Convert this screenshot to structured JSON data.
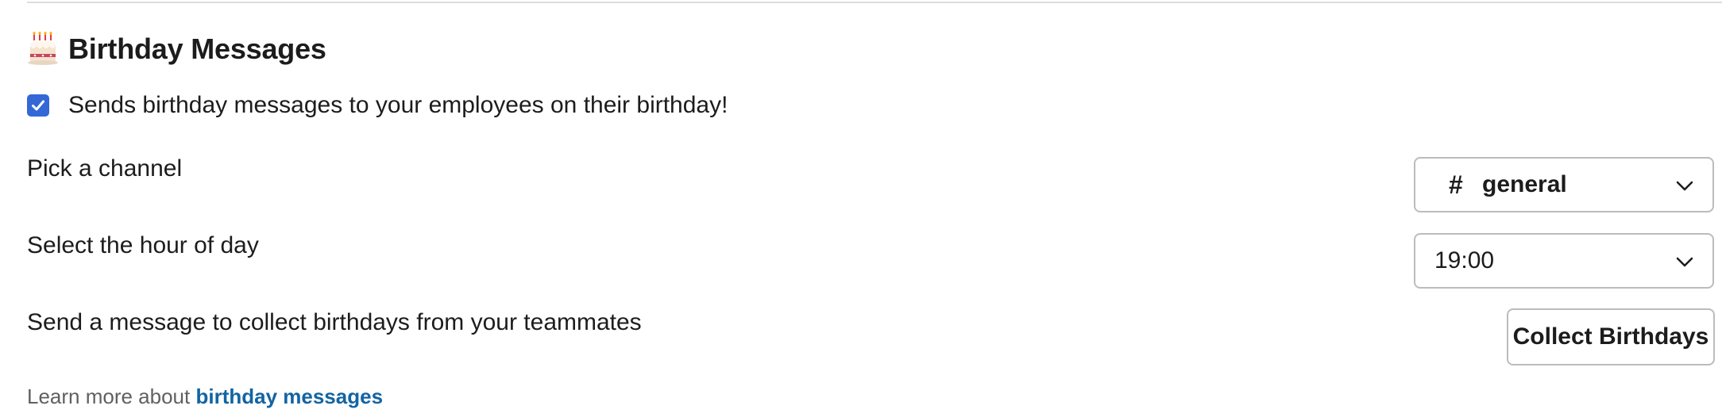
{
  "section": {
    "title": "Birthday Messages",
    "icon": "birthday-cake-icon"
  },
  "enable": {
    "checked": true,
    "label": "Sends birthday messages to your employees on their birthday!"
  },
  "channel": {
    "label": "Pick a channel",
    "prefix": "#",
    "value": "general"
  },
  "hour": {
    "label": "Select the hour of day",
    "value": "19:00"
  },
  "collect": {
    "label": "Send a message to collect birthdays from your teammates",
    "button_label": "Collect Birthdays"
  },
  "footer": {
    "text": "Learn more about",
    "link_text": "birthday messages"
  },
  "colors": {
    "checkbox": "#3468d6",
    "link": "#1264a3",
    "border": "#bcbcbc"
  }
}
